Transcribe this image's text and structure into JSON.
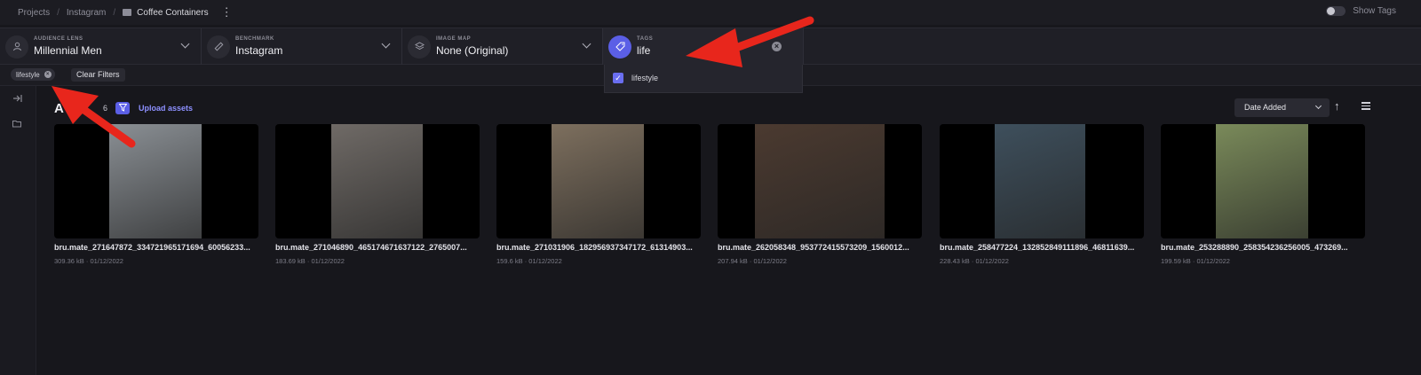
{
  "breadcrumb": {
    "projects": "Projects",
    "instagram": "Instagram",
    "current": "Coffee Containers",
    "more": "⋮"
  },
  "header": {
    "show_tags": "Show Tags"
  },
  "filters": [
    {
      "label": "AUDIENCE LENS",
      "value": "Millennial Men",
      "icon": "person-icon"
    },
    {
      "label": "BENCHMARK",
      "value": "Instagram",
      "icon": "ruler-icon"
    },
    {
      "label": "IMAGE MAP",
      "value": "None (Original)",
      "icon": "layers-icon"
    },
    {
      "label": "TAGS",
      "value": "life",
      "icon": "tag-icon"
    }
  ],
  "active_filters": {
    "chip": "lifestyle",
    "clear": "Clear Filters"
  },
  "tag_dropdown": {
    "option": "lifestyle",
    "checked": true
  },
  "assets": {
    "title": "A",
    "count": "6",
    "upload": "Upload assets",
    "sort": "Date Added",
    "items": [
      {
        "name": "bru.mate_271647872_334721965171694_60056233...",
        "meta": "309.36 kB · 01/12/2022",
        "photo_color": "#8a8f94"
      },
      {
        "name": "bru.mate_271046890_465174671637122_2765007...",
        "meta": "183.69 kB · 01/12/2022",
        "photo_color": "#6f6a66"
      },
      {
        "name": "bru.mate_271031906_182956937347172_61314903...",
        "meta": "159.6 kB · 01/12/2022",
        "photo_color": "#7d6f5e"
      },
      {
        "name": "bru.mate_262058348_953772415573209_1560012...",
        "meta": "207.94 kB · 01/12/2022",
        "photo_color": "#4b3a30"
      },
      {
        "name": "bru.mate_258477224_132852849111896_46811639...",
        "meta": "228.43 kB · 01/12/2022",
        "photo_color": "#3e4f5c"
      },
      {
        "name": "bru.mate_253288890_258354236256005_473269...",
        "meta": "199.59 kB · 01/12/2022",
        "photo_color": "#7a8a5a"
      }
    ]
  },
  "colors": {
    "accent": "#5b5fe6",
    "annotation": "#e8261c"
  }
}
